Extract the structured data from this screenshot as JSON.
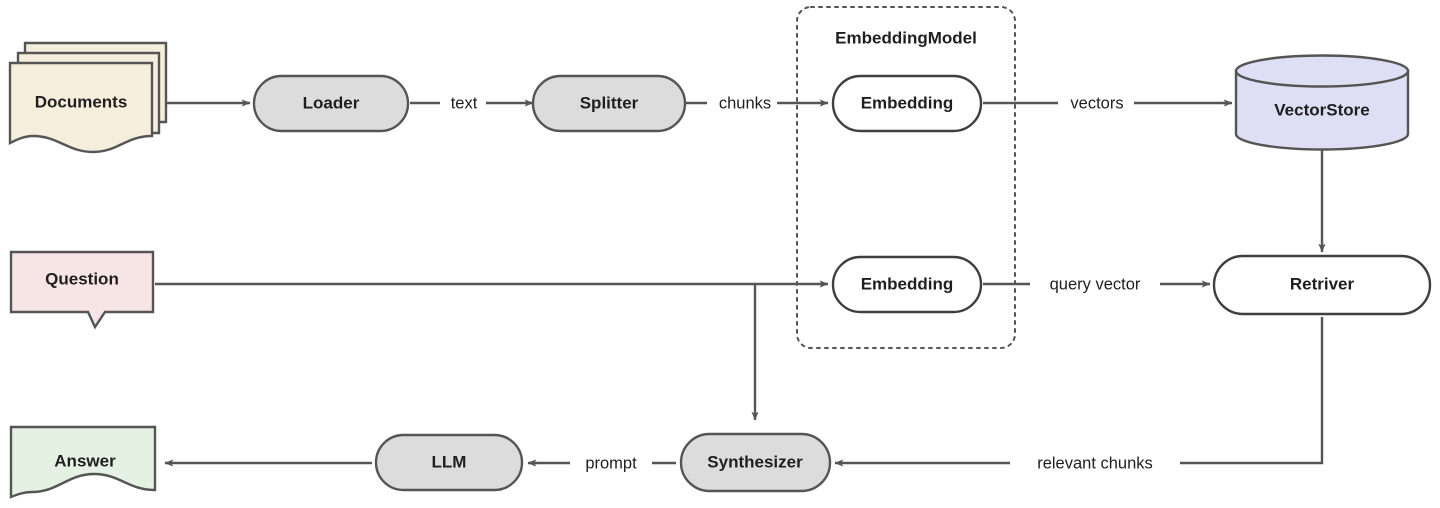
{
  "diagram": {
    "title": "RAG pipeline flowchart",
    "background": "#ffffff",
    "colors": {
      "stroke": "#555555",
      "text": "#1f1f1f",
      "process_fill": "#dcdcdc",
      "plain_fill": "#ffffff",
      "documents_fill": "#f5eedd",
      "question_fill": "#f7e4e5",
      "answer_fill": "#e4f1e3",
      "vectorstore_fill": "#dedef5"
    },
    "group": {
      "label": "EmbeddingModel",
      "border_style": "dotted"
    },
    "nodes": [
      {
        "id": "documents",
        "label": "Documents",
        "shape": "multi-document",
        "fill": "#f5eedd"
      },
      {
        "id": "loader",
        "label": "Loader",
        "shape": "stadium",
        "fill": "#dcdcdc"
      },
      {
        "id": "splitter",
        "label": "Splitter",
        "shape": "stadium",
        "fill": "#dcdcdc"
      },
      {
        "id": "embedding1",
        "label": "Embedding",
        "shape": "stadium",
        "fill": "#ffffff"
      },
      {
        "id": "vectorstore",
        "label": "VectorStore",
        "shape": "cylinder",
        "fill": "#dedef5"
      },
      {
        "id": "question",
        "label": "Question",
        "shape": "comment",
        "fill": "#f7e4e5"
      },
      {
        "id": "embedding2",
        "label": "Embedding",
        "shape": "stadium",
        "fill": "#ffffff"
      },
      {
        "id": "retriver",
        "label": "Retriver",
        "shape": "stadium",
        "fill": "#ffffff"
      },
      {
        "id": "answer",
        "label": "Answer",
        "shape": "document",
        "fill": "#e4f1e3"
      },
      {
        "id": "llm",
        "label": "LLM",
        "shape": "stadium",
        "fill": "#dcdcdc"
      },
      {
        "id": "synthesizer",
        "label": "Synthesizer",
        "shape": "stadium",
        "fill": "#dcdcdc"
      }
    ],
    "edges": [
      {
        "id": "e1",
        "from": "documents",
        "to": "loader",
        "label": ""
      },
      {
        "id": "e2",
        "from": "loader",
        "to": "splitter",
        "label": "text"
      },
      {
        "id": "e3",
        "from": "splitter",
        "to": "embedding1",
        "label": "chunks"
      },
      {
        "id": "e4",
        "from": "embedding1",
        "to": "vectorstore",
        "label": "vectors"
      },
      {
        "id": "e5",
        "from": "vectorstore",
        "to": "retriver",
        "label": ""
      },
      {
        "id": "e6",
        "from": "question",
        "to": "embedding2",
        "label": ""
      },
      {
        "id": "e7",
        "from": "embedding2",
        "to": "retriver",
        "label": "query vector"
      },
      {
        "id": "e8",
        "from": "question",
        "to": "synthesizer",
        "label": ""
      },
      {
        "id": "e9",
        "from": "retriver",
        "to": "synthesizer",
        "label": "relevant chunks"
      },
      {
        "id": "e10",
        "from": "synthesizer",
        "to": "llm",
        "label": "prompt"
      },
      {
        "id": "e11",
        "from": "llm",
        "to": "answer",
        "label": ""
      }
    ]
  }
}
